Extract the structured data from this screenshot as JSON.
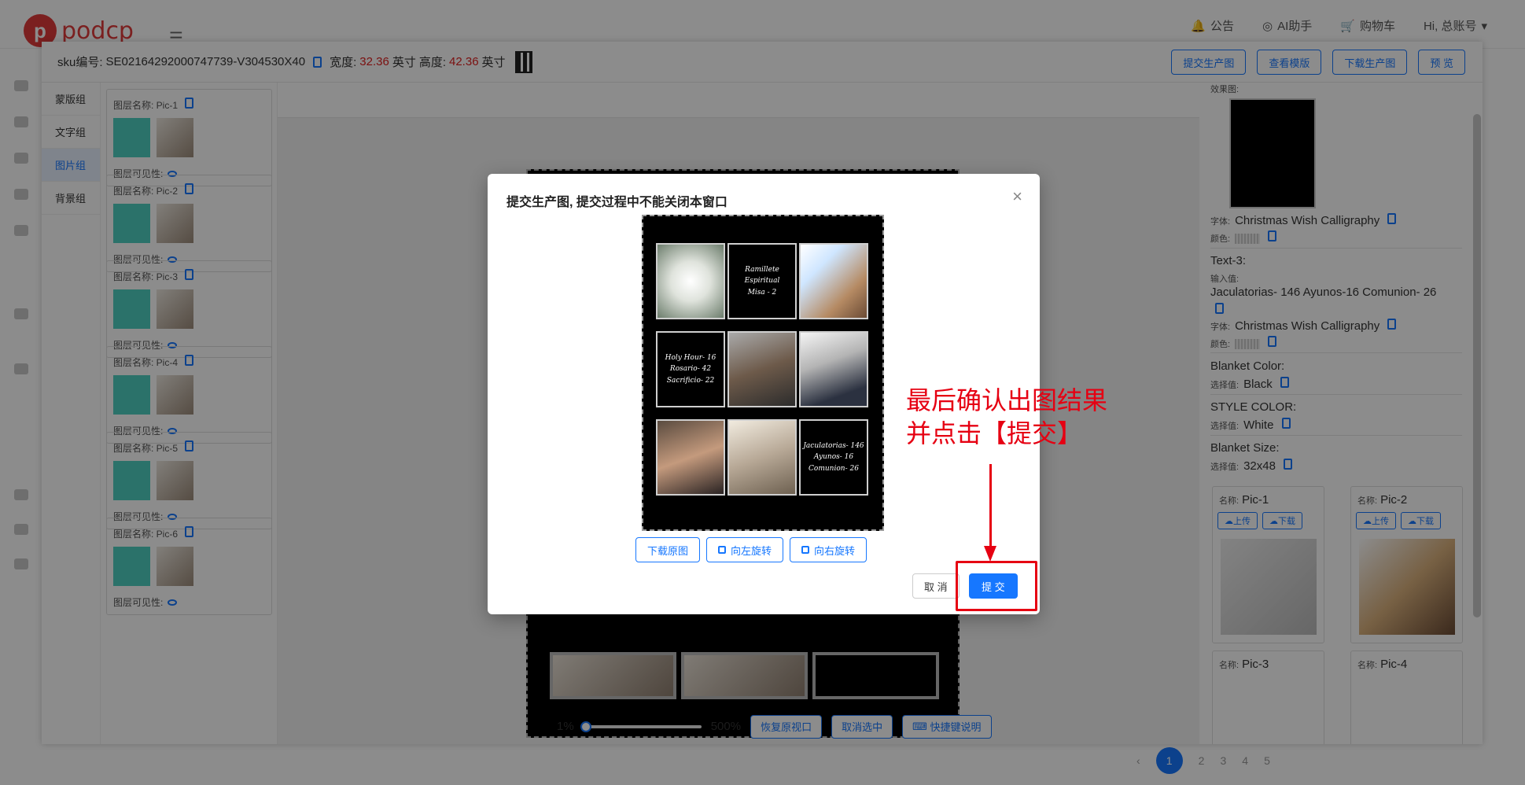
{
  "app": {
    "logo_letter": "p",
    "logo_text": "podcp",
    "hamburger": "☰",
    "nav": [
      "公告",
      "AI助手",
      "购物车",
      "Hi, 总账号"
    ],
    "pagination": {
      "current": "1",
      "pages": [
        "2",
        "3",
        "4",
        "5"
      ]
    }
  },
  "editor": {
    "sku_label": "sku编号:",
    "sku_value": "SE02164292000747739-V304530X40",
    "width_label": "宽度:",
    "width_value": "32.36",
    "width_unit": "英寸",
    "height_label": "高度:",
    "height_value": "42.36",
    "height_unit": "英寸",
    "buttons": [
      "提交生产图",
      "查看模版",
      "下载生产图",
      "预 览"
    ],
    "tabs": [
      "蒙版组",
      "文字组",
      "图片组",
      "背景组"
    ],
    "active_tab": "图片组",
    "layers": [
      {
        "name": "图层名称: Pic-1",
        "visible": "图层可见性:"
      },
      {
        "name": "图层名称: Pic-2",
        "visible": "图层可见性:"
      },
      {
        "name": "图层名称: Pic-3",
        "visible": "图层可见性:"
      },
      {
        "name": "图层名称: Pic-4",
        "visible": "图层可见性:"
      },
      {
        "name": "图层名称: Pic-5",
        "visible": "图层可见性:"
      },
      {
        "name": "图层名称: Pic-6",
        "visible": "图层可见性:"
      }
    ],
    "zoom": {
      "min": "1%",
      "max": "500%",
      "restore": "恢复原视口",
      "deselect": "取消选中",
      "shortcuts": "快捷键说明"
    },
    "right_panel": {
      "effect_label": "效果图:",
      "font_label": "字体:",
      "font_value": "Christmas Wish Calligraphy",
      "color_label": "颜色:",
      "text3_title": "Text-3:",
      "input_label": "输入值:",
      "text3_value": "Jaculatorias- 146 Ayunos-16 Comunion- 26",
      "blanket_color_title": "Blanket Color:",
      "select_label": "选择值:",
      "blanket_color_value": "Black",
      "style_color_title": "STYLE COLOR:",
      "style_color_value": "White",
      "blanket_size_title": "Blanket Size:",
      "blanket_size_value": "32x48",
      "pic_cards": [
        {
          "label": "名称:",
          "name": "Pic-1",
          "upload": "上传",
          "download": "下载"
        },
        {
          "label": "名称:",
          "name": "Pic-2",
          "upload": "上传",
          "download": "下载"
        },
        {
          "label": "名称:",
          "name": "Pic-3"
        },
        {
          "label": "名称:",
          "name": "Pic-4"
        }
      ]
    }
  },
  "modal": {
    "title": "提交生产图, 提交过程中不能关闭本窗口",
    "close": "×",
    "grid": [
      {
        "kind": "photo1",
        "text": ""
      },
      {
        "kind": "text",
        "text": "Ramillete Espiritual\nMisa - 2"
      },
      {
        "kind": "photo2",
        "text": ""
      },
      {
        "kind": "text",
        "text": "Holy Hour- 16\nRosario- 42\nSacrificio- 22"
      },
      {
        "kind": "photo3",
        "text": ""
      },
      {
        "kind": "photo4",
        "text": ""
      },
      {
        "kind": "photo5",
        "text": ""
      },
      {
        "kind": "photo6",
        "text": ""
      },
      {
        "kind": "text",
        "text": "Jaculatorias- 146\nAyunos- 16\nComunion- 26"
      }
    ],
    "download_original": "下载原图",
    "rotate_left": "向左旋转",
    "rotate_right": "向右旋转",
    "cancel": "取 消",
    "submit": "提 交"
  },
  "annotation": {
    "text": "最后确认出图结果\n并点击【提交】",
    "color": "#e60012"
  },
  "colors": {
    "accent": "#1677ff",
    "highlight": "#e02020",
    "teal": "#4fd0c2"
  }
}
